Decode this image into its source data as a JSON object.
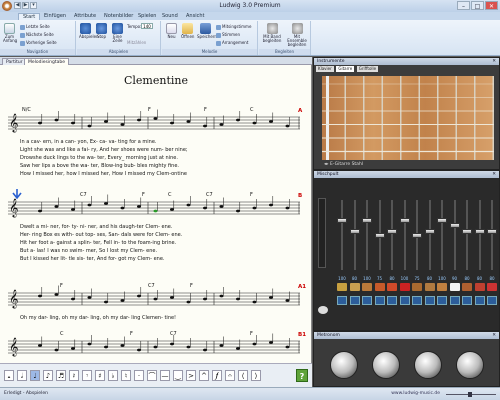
{
  "window": {
    "title": "Ludwig 3.0 Premium",
    "qat": [
      "◀",
      "▶",
      "▾"
    ],
    "controls": {
      "minimize": "–",
      "maximize": "□",
      "close": "✕"
    }
  },
  "ribbon_tabs": [
    "Start",
    "Einfügen",
    "Attribute",
    "Notenbilder",
    "Spielen",
    "Sound",
    "Ansicht"
  ],
  "ribbon": {
    "groups": [
      "Navigation",
      "Abspielen",
      "Melodie",
      "Begleiten"
    ],
    "nav": {
      "zoom": "Zum Anfang",
      "last": "Letzte Seite",
      "next": "Nächste Seite",
      "prev": "Vorherige Seite"
    },
    "play": {
      "play": "Abspielen",
      "stop": "Stop",
      "one_line": "Eine Zeile",
      "tempo_label": "Tempo:",
      "tempo_value": "140",
      "other": "Mitzählen"
    },
    "melody": {
      "new": "Neu",
      "open": "Öffnen",
      "save": "Speichern",
      "m1": "Mitsingstimme",
      "m2": "Stimmen",
      "m3": "Arrangement"
    },
    "accomp": {
      "band": "Mit Band begleiten",
      "ensemble": "Mit Ensemble begleiten"
    }
  },
  "doc_tabs": [
    "Partitur",
    "Melodiesingtabe"
  ],
  "score": {
    "title": "Clementine",
    "systems": [
      {
        "chords": [
          "N/C",
          "F",
          "F",
          "C"
        ],
        "mark": "A",
        "lyrics": [
          "In   a    cav-  ern,    in    a    can-  yon,   Ex-  ca-    va-   ting   for    a        mine.",
          "Light  she   was    and   like    a    fai-   ry,    And   her    shoes  were   num-  ber     nine;",
          "Drowshe   duck   lings   to    the     wa-    ter,  Every_   morning   just    at      nine.",
          "Saw  her   lips    a   bove  the     wa-    ter,   Blow-ing    bub-  bles   mighty    fine.",
          "How   I     missed  her,   how    I     missed   her,    How  I    missed   my  Clem-ontine"
        ]
      },
      {
        "chords": [
          "C7",
          "F",
          "C",
          "C7",
          "F"
        ],
        "mark": "B",
        "lyrics": [
          "Dwelt a     mi-   ner,   for-   ty-     ni-   ner,  and  his    daugh-ter    Clem-  ene.",
          "Her-  ring  Box    es    with-  out   top-  ses,  San-  dals  were   for     Clem-  ene.",
          "Hit   her   foot    a-  gainst a    splin-  ter,   Fell   in-   to   the  foam-ing    brine.",
          "But    a-   las!     I    was   no    swim-  mer,    So    I     lost   my    Clem-  ene.",
          "But    I    kissed  her  lit-   tle      sis-   ter,   And  for-   got   my    Clem-  ene."
        ]
      },
      {
        "chords": [
          "F",
          "C7",
          "F"
        ],
        "mark": "A1",
        "lyrics": [
          "Oh   my   dar-  ling,   oh   my     dar-   ling,   oh   my     dar-  ling   Clemen-  tine!"
        ]
      },
      {
        "chords": [
          "C",
          "F",
          "C7",
          "F"
        ],
        "mark": "B1",
        "lyrics": []
      }
    ]
  },
  "note_toolbar": {
    "buttons": [
      "𝅝",
      "𝅗𝅥",
      "♩",
      "♪",
      "♬",
      "𝄽",
      "𝄾",
      "♯",
      "♭",
      "♮",
      "·",
      "⌒",
      "—",
      "‿",
      ">",
      "^",
      "𝆑",
      "𝄐",
      "⟨",
      "⟩"
    ],
    "help": "?"
  },
  "status": {
    "text": "Erledigt - Abspielen",
    "url": "www.ludwig-music.de"
  },
  "instruments_panel": {
    "title": "Instrumente",
    "tabs": [
      "Klavier",
      "Gitarre",
      "Grifftolle"
    ],
    "instrument_name": "E-Gitarre Stahl"
  },
  "mixer_panel": {
    "title": "Mischpult",
    "channels": [
      {
        "value": "100",
        "level": 0.72,
        "color": "#c8a040"
      },
      {
        "value": "80",
        "level": 0.55,
        "color": "#caa050"
      },
      {
        "value": "100",
        "level": 0.72,
        "color": "#bb7a3a"
      },
      {
        "value": "75",
        "level": 0.5,
        "color": "#c85a2a"
      },
      {
        "value": "80",
        "level": 0.55,
        "color": "#d04a2a"
      },
      {
        "value": "100",
        "level": 0.72,
        "color": "#cc2222"
      },
      {
        "value": "75",
        "level": 0.5,
        "color": "#a86a30"
      },
      {
        "value": "80",
        "level": 0.55,
        "color": "#b07a40"
      },
      {
        "value": "100",
        "level": 0.72,
        "color": "#c08040"
      },
      {
        "value": "90",
        "level": 0.64,
        "color": "#f0f0f0"
      },
      {
        "value": "80",
        "level": 0.55,
        "color": "#b06030"
      },
      {
        "value": "80",
        "level": 0.55,
        "color": "#c04030"
      },
      {
        "value": "80",
        "level": 0.55,
        "color": "#cc3333"
      }
    ]
  },
  "metronome_panel": {
    "title": "Metronom"
  }
}
